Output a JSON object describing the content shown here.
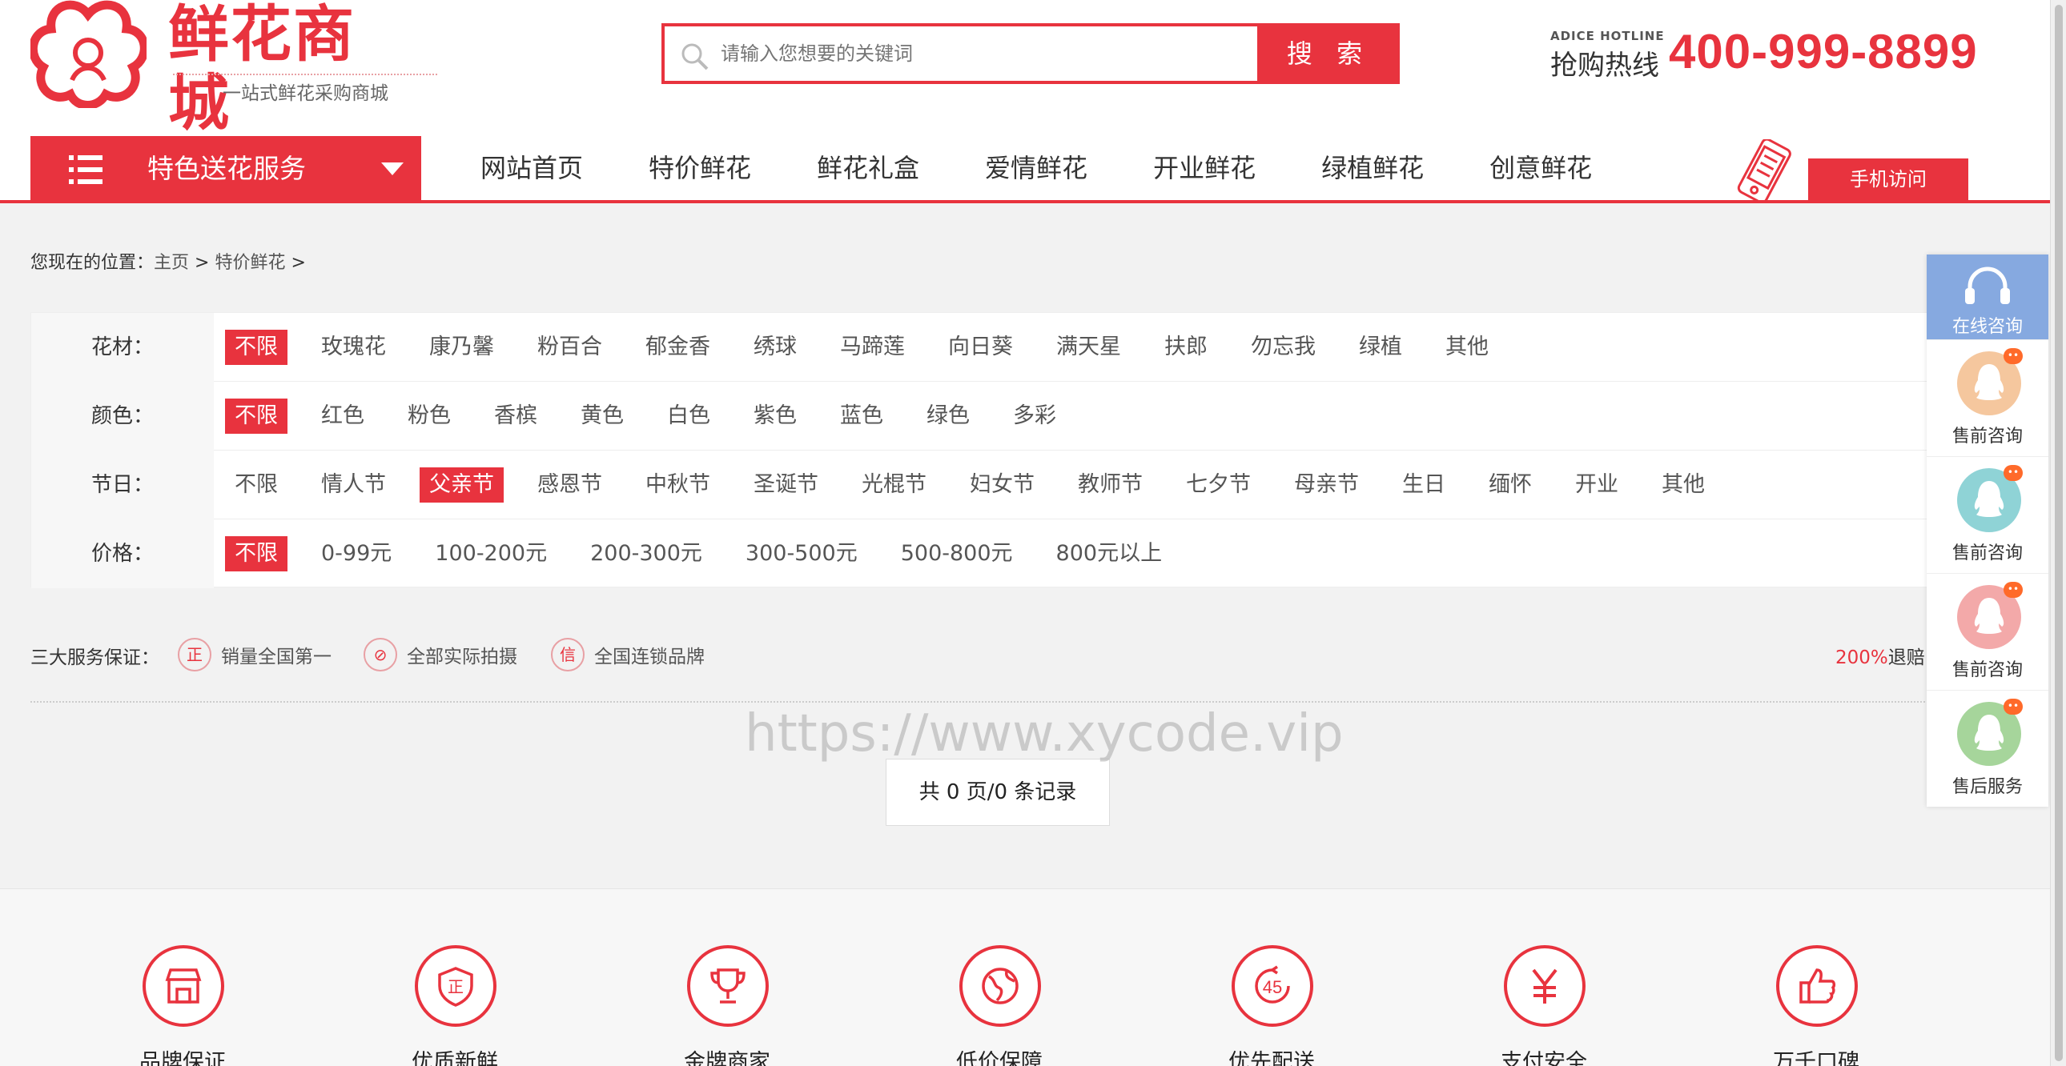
{
  "header": {
    "logo_title": "鲜花商城",
    "logo_subtitle": "一站式鲜花采购商城",
    "search_placeholder": "请输入您想要的关键词",
    "search_button": "搜 索",
    "hotline_en": "ADICE HOTLINE",
    "hotline_cn": "抢购热线",
    "hotline_number": "400-999-8899"
  },
  "nav": {
    "category_label": "特色送花服务",
    "links": [
      "网站首页",
      "特价鲜花",
      "鲜花礼盒",
      "爱情鲜花",
      "开业鲜花",
      "绿植鲜花",
      "创意鲜花"
    ],
    "mobile_button": "手机访问"
  },
  "breadcrumb": {
    "prefix": "您现在的位置：",
    "home": "主页",
    "sep1": " > ",
    "current": "特价鲜花",
    "sep2": " >"
  },
  "filters": [
    {
      "label": "花材：",
      "selected": 0,
      "options": [
        "不限",
        "玫瑰花",
        "康乃馨",
        "粉百合",
        "郁金香",
        "绣球",
        "马蹄莲",
        "向日葵",
        "满天星",
        "扶郎",
        "勿忘我",
        "绿植",
        "其他"
      ]
    },
    {
      "label": "颜色：",
      "selected": 0,
      "options": [
        "不限",
        "红色",
        "粉色",
        "香槟",
        "黄色",
        "白色",
        "紫色",
        "蓝色",
        "绿色",
        "多彩"
      ]
    },
    {
      "label": "节日：",
      "selected": 2,
      "options": [
        "不限",
        "情人节",
        "父亲节",
        "感恩节",
        "中秋节",
        "圣诞节",
        "光棍节",
        "妇女节",
        "教师节",
        "七夕节",
        "母亲节",
        "生日",
        "缅怀",
        "开业",
        "其他"
      ]
    },
    {
      "label": "价格：",
      "selected": 0,
      "options": [
        "不限",
        "0-99元",
        "100-200元",
        "200-300元",
        "300-500元",
        "500-800元",
        "800元以上"
      ]
    }
  ],
  "services": {
    "title": "三大服务保证：",
    "items": [
      {
        "badge": "正",
        "label": "销量全国第一"
      },
      {
        "badge": "⊘",
        "label": "全部实际拍摄"
      },
      {
        "badge": "信",
        "label": "全国连锁品牌"
      }
    ],
    "right_highlight": "200%",
    "right_text": "退赔"
  },
  "pager": {
    "text": "共 0 页/0 条记录"
  },
  "watermark": "https://www.xycode.vip",
  "features": [
    {
      "icon": "shop-icon",
      "label": "品牌保证"
    },
    {
      "icon": "shield-icon",
      "label": "优质新鲜"
    },
    {
      "icon": "trophy-icon",
      "label": "金牌商家"
    },
    {
      "icon": "globe-icon",
      "label": "低价保障"
    },
    {
      "icon": "timer-45-icon",
      "label": "优先配送"
    },
    {
      "icon": "yen-icon",
      "label": "支付安全"
    },
    {
      "icon": "thumbs-up-icon",
      "label": "万千口碑"
    }
  ],
  "float_bar": {
    "top_label": "在线咨询",
    "items": [
      {
        "label": "售前咨询",
        "color": "#f5c79e"
      },
      {
        "label": "售前咨询",
        "color": "#8fd3d6"
      },
      {
        "label": "售前咨询",
        "color": "#f3a9a9"
      },
      {
        "label": "售后服务",
        "color": "#a6d59b"
      }
    ]
  },
  "colors": {
    "brand_red": "#e8333e",
    "float_blue": "#86a9e0"
  }
}
